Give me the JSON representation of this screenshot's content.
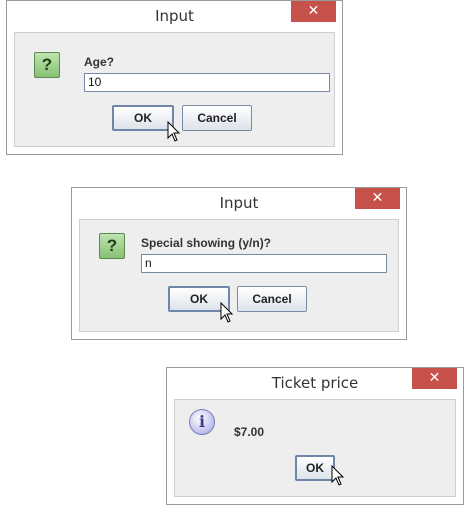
{
  "dialog_age": {
    "title": "Input",
    "close_glyph": "✕",
    "icon": "question-icon",
    "icon_glyph": "?",
    "prompt": "Age?",
    "input_value": "10",
    "ok_label": "OK",
    "cancel_label": "Cancel"
  },
  "dialog_special": {
    "title": "Input",
    "close_glyph": "✕",
    "icon": "question-icon",
    "icon_glyph": "?",
    "prompt": "Special showing (y/n)?",
    "input_value": "n",
    "ok_label": "OK",
    "cancel_label": "Cancel"
  },
  "dialog_price": {
    "title": "Ticket price",
    "close_glyph": "✕",
    "icon": "information-icon",
    "icon_glyph": "i",
    "message": "$7.00",
    "ok_label": "OK"
  },
  "colors": {
    "close_button": "#c7524a",
    "client_background": "#eeeeee",
    "question_icon": "#86c272",
    "info_icon": "#b8b8ea"
  }
}
